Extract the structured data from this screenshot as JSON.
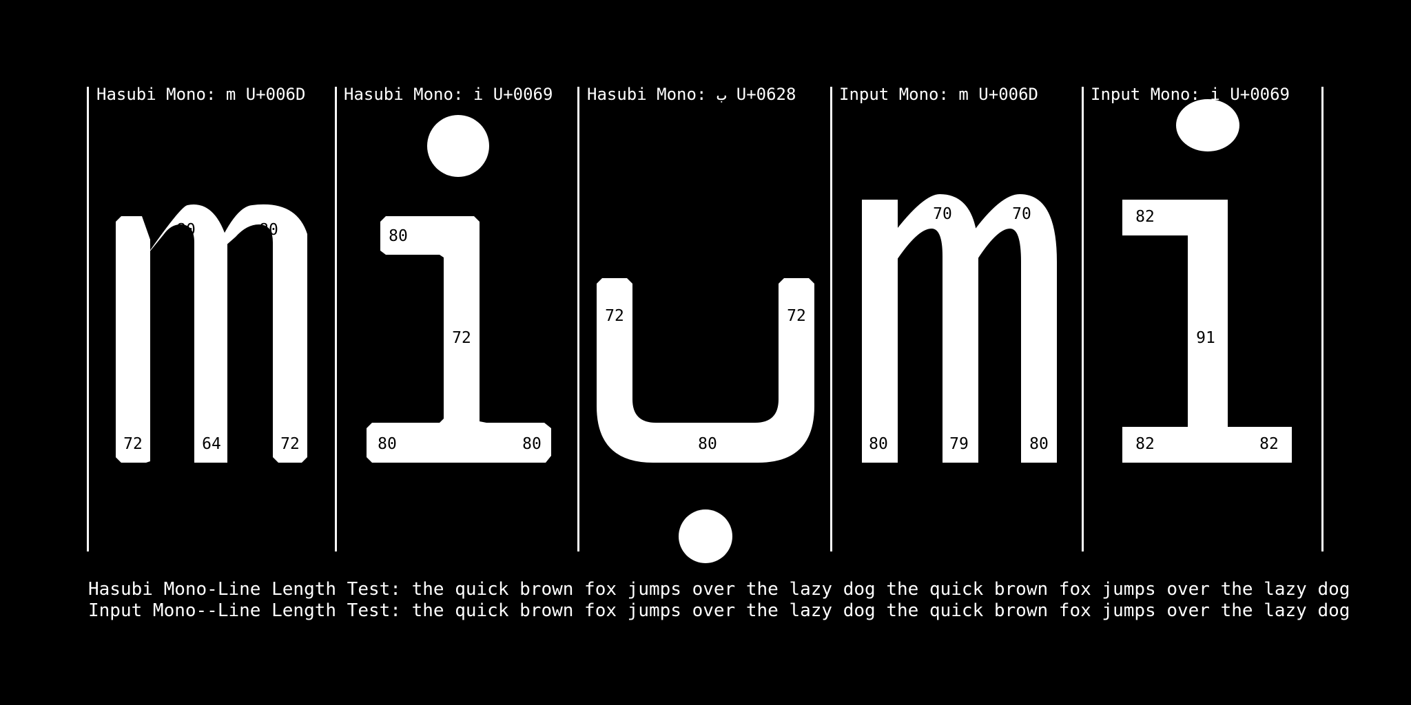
{
  "panels": [
    {
      "label": "Hasubi Mono: m U+006D",
      "metrics": [
        "80",
        "80",
        "72",
        "64",
        "72"
      ]
    },
    {
      "label": "Hasubi Mono: i U+0069",
      "metrics": [
        "80",
        "72",
        "80",
        "80"
      ]
    },
    {
      "label": "Hasubi Mono: ب U+0628",
      "metrics": [
        "72",
        "72",
        "80"
      ]
    },
    {
      "label": "Input Mono: m U+006D",
      "metrics": [
        "70",
        "70",
        "80",
        "79",
        "80"
      ]
    },
    {
      "label": "Input Mono: i U+0069",
      "metrics": [
        "82",
        "91",
        "82",
        "82"
      ]
    }
  ],
  "tests": [
    "Hasubi Mono-Line Length Test: the quick brown fox jumps over the lazy dog the quick brown fox jumps over the lazy dog",
    "Input Mono--Line Length Test: the quick brown fox jumps over the lazy dog the quick brown fox jumps over the lazy dog"
  ]
}
